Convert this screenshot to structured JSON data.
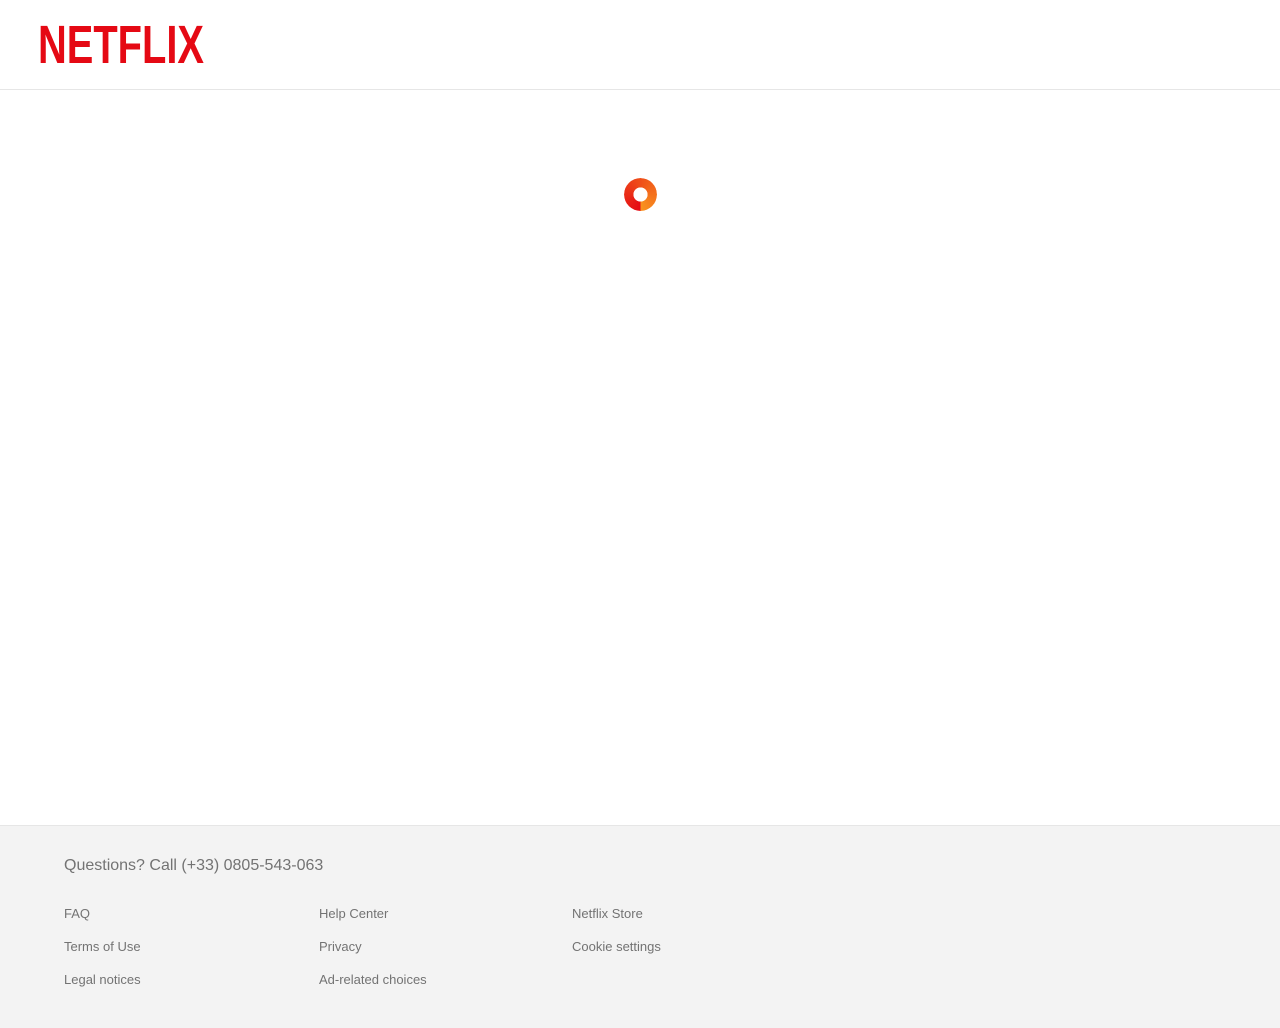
{
  "header": {
    "logo_text": "NETFLIX"
  },
  "main": {
    "spinner": {
      "icon": "loading-spinner-icon",
      "state": "loading"
    }
  },
  "footer": {
    "questions_label": "Questions? Call (+33) 0805-543-063",
    "links": [
      {
        "label": "FAQ"
      },
      {
        "label": "Terms of Use"
      },
      {
        "label": "Legal notices"
      },
      {
        "label": "Help Center"
      },
      {
        "label": "Privacy"
      },
      {
        "label": "Ad-related choices"
      },
      {
        "label": "Netflix Store"
      },
      {
        "label": "Cookie settings"
      }
    ]
  },
  "colors": {
    "brand_red": "#e50914",
    "spinner_red": "#e50914",
    "spinner_orange": "#f9941f",
    "footer_background": "#f3f3f3",
    "footer_text": "#737373",
    "divider": "#e6e6e6"
  }
}
